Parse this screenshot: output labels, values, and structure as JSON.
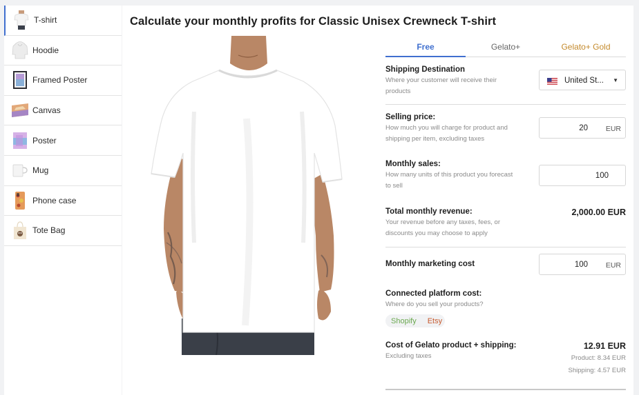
{
  "sidebar": {
    "items": [
      {
        "label": "T-shirt",
        "icon": "tshirt-thumbnail"
      },
      {
        "label": "Hoodie",
        "icon": "hoodie-thumbnail"
      },
      {
        "label": "Framed Poster",
        "icon": "framed-poster-thumbnail"
      },
      {
        "label": "Canvas",
        "icon": "canvas-thumbnail"
      },
      {
        "label": "Poster",
        "icon": "poster-thumbnail"
      },
      {
        "label": "Mug",
        "icon": "mug-thumbnail"
      },
      {
        "label": "Phone case",
        "icon": "phone-case-thumbnail"
      },
      {
        "label": "Tote Bag",
        "icon": "tote-bag-thumbnail"
      }
    ]
  },
  "main": {
    "title": "Calculate your monthly profits for Classic Unisex Crewneck T-shirt"
  },
  "tabs": [
    {
      "label": "Free"
    },
    {
      "label": "Gelato+"
    },
    {
      "label": "Gelato+ Gold"
    }
  ],
  "shipping": {
    "label": "Shipping Destination",
    "help": "Where your customer will receive their products",
    "value": "United St..."
  },
  "selling_price": {
    "label": "Selling price:",
    "help": "How much you will charge for product and shipping per item, excluding taxes",
    "value": "20",
    "unit": "EUR"
  },
  "monthly_sales": {
    "label": "Monthly sales:",
    "help": "How many units of this product you forecast to sell",
    "value": "100"
  },
  "revenue": {
    "label": "Total monthly revenue:",
    "help": "Your revenue before any taxes, fees, or discounts you may choose to apply",
    "value": "2,000.00 EUR"
  },
  "marketing": {
    "label": "Monthly marketing cost",
    "value": "100",
    "unit": "EUR"
  },
  "platform": {
    "label": "Connected platform cost:",
    "help": "Where do you sell your products?",
    "options": [
      "Shopify",
      "Etsy"
    ]
  },
  "cost": {
    "label": "Cost of Gelato product + shipping:",
    "help": "Excluding taxes",
    "value": "12.91 EUR",
    "product": "Product: 8.34 EUR",
    "shipping": "Shipping: 4.57 EUR"
  },
  "colors": {
    "accent": "#3f6fcf",
    "gold": "#c48a2c",
    "shopify": "#6aa84f",
    "etsy": "#c75b2f"
  }
}
